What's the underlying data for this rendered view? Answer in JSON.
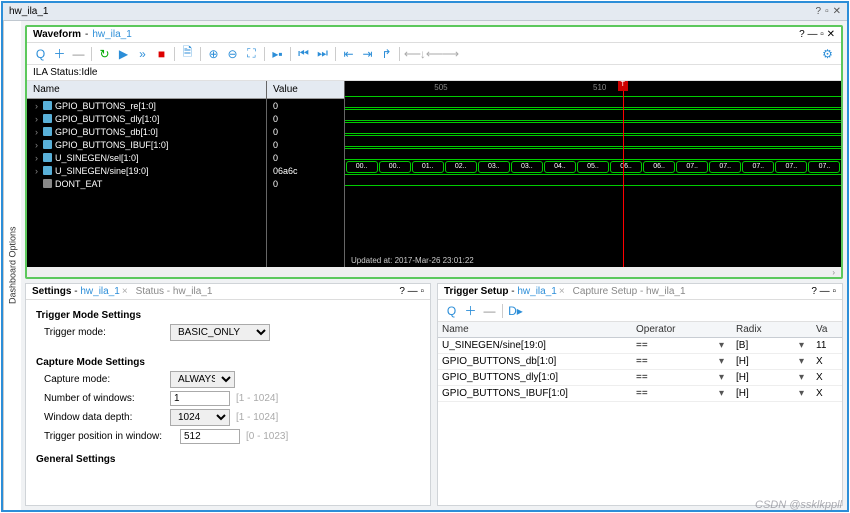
{
  "window_title": "hw_ila_1",
  "side_tab": "Dashboard Options",
  "waveform": {
    "title": "Waveform",
    "sub": "hw_ila_1",
    "status": "ILA Status:Idle",
    "name_header": "Name",
    "value_header": "Value",
    "signals": [
      {
        "name": "GPIO_BUTTONS_re[1:0]",
        "value": "0",
        "exp": "›"
      },
      {
        "name": "GPIO_BUTTONS_dly[1:0]",
        "value": "0",
        "exp": "›"
      },
      {
        "name": "GPIO_BUTTONS_db[1:0]",
        "value": "0",
        "exp": "›"
      },
      {
        "name": "GPIO_BUTTONS_IBUF[1:0]",
        "value": "0",
        "exp": "›"
      },
      {
        "name": "U_SINEGEN/sel[1:0]",
        "value": "0",
        "exp": "›"
      },
      {
        "name": "U_SINEGEN/sine[19:0]",
        "value": "06a6c",
        "exp": "›"
      },
      {
        "name": "DONT_EAT",
        "value": "0",
        "exp": "",
        "gray": true
      }
    ],
    "ticks": [
      "505",
      "510"
    ],
    "marker_flag": "T",
    "bus_cells": [
      "00..",
      "00..",
      "01..",
      "02..",
      "03..",
      "03..",
      "04..",
      "05..",
      "06..",
      "06..",
      "07..",
      "07..",
      "07..",
      "07..",
      "07.."
    ],
    "footer": "Updated at: 2017-Mar-26 23:01:22"
  },
  "settings_panel": {
    "tab1": "Settings",
    "tab1_sub": "hw_ila_1",
    "tab2": "Status - hw_ila_1",
    "trigger_heading": "Trigger Mode Settings",
    "trigger_mode_label": "Trigger mode:",
    "trigger_mode_value": "BASIC_ONLY",
    "capture_heading": "Capture Mode Settings",
    "capture_mode_label": "Capture mode:",
    "capture_mode_value": "ALWAYS",
    "num_windows_label": "Number of windows:",
    "num_windows_value": "1",
    "num_windows_hint": "[1 - 1024]",
    "depth_label": "Window data depth:",
    "depth_value": "1024",
    "depth_hint": "[1 - 1024]",
    "trig_pos_label": "Trigger position in window:",
    "trig_pos_value": "512",
    "trig_pos_hint": "[0 - 1023]",
    "general_heading": "General Settings"
  },
  "trigger_panel": {
    "tab1": "Trigger Setup",
    "tab1_sub": "hw_ila_1",
    "tab2": "Capture Setup - hw_ila_1",
    "headers": {
      "name": "Name",
      "operator": "Operator",
      "radix": "Radix",
      "value": "Va"
    },
    "rows": [
      {
        "name": "U_SINEGEN/sine[19:0]",
        "op": "==",
        "radix": "[B]",
        "val": "11"
      },
      {
        "name": "GPIO_BUTTONS_db[1:0]",
        "op": "==",
        "radix": "[H]",
        "val": "X"
      },
      {
        "name": "GPIO_BUTTONS_dly[1:0]",
        "op": "==",
        "radix": "[H]",
        "val": "X"
      },
      {
        "name": "GPIO_BUTTONS_IBUF[1:0]",
        "op": "==",
        "radix": "[H]",
        "val": "X"
      }
    ]
  },
  "watermark": "CSDN @ssklkppll"
}
